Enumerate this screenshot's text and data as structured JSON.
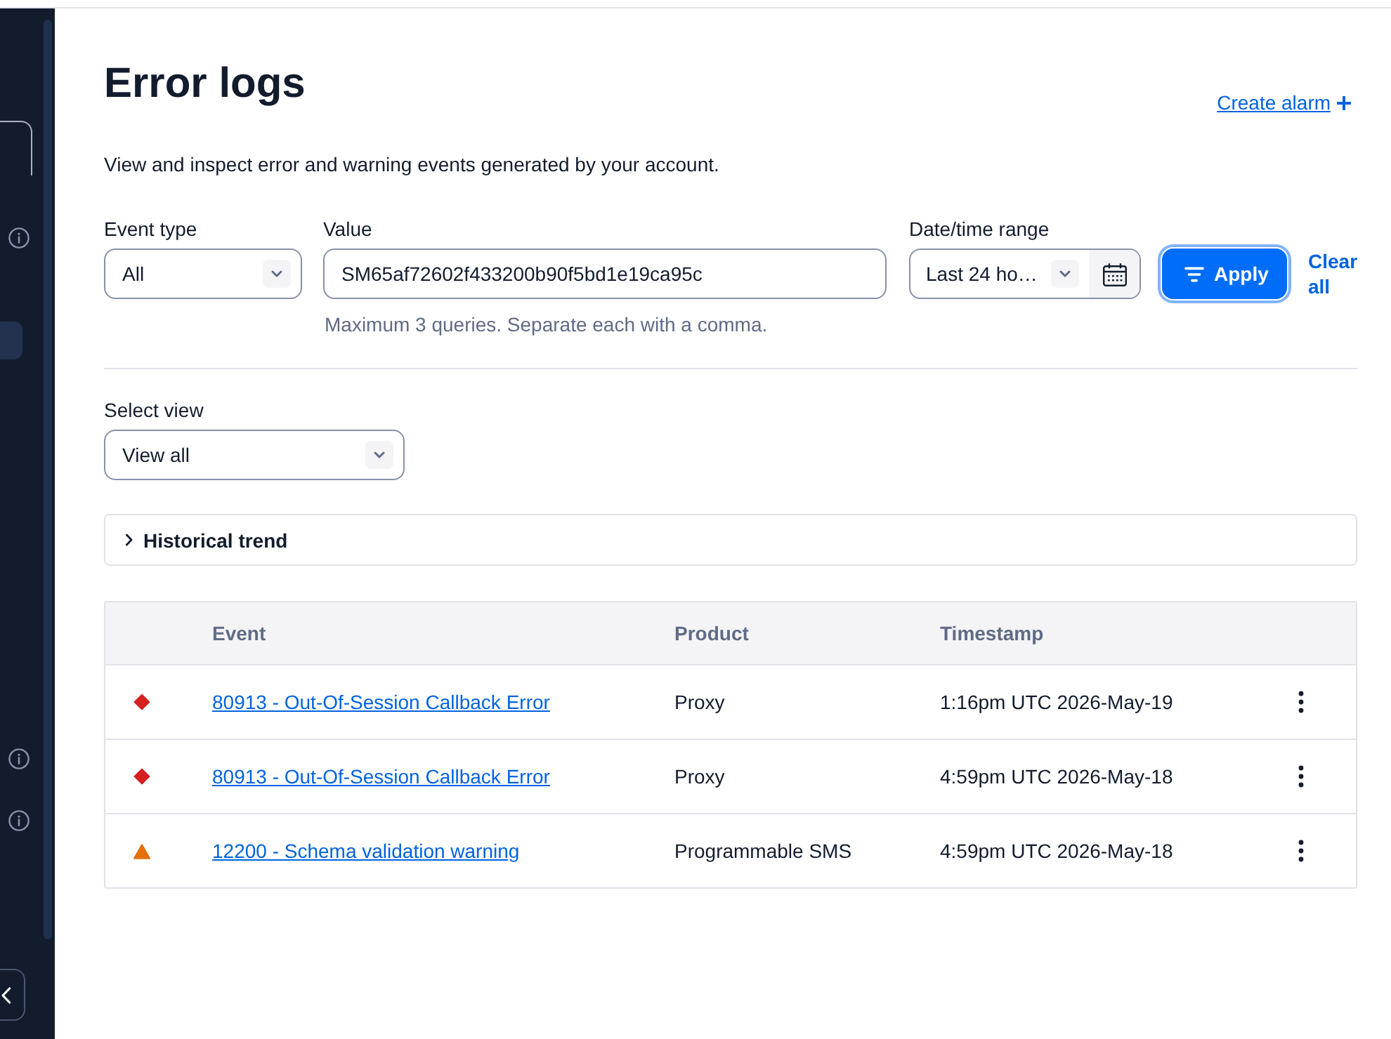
{
  "sidebar": {
    "active_item": {
      "selected": true
    }
  },
  "header": {
    "title": "Error logs",
    "create_alarm": "Create alarm",
    "description": "View and inspect error and warning events generated by your account."
  },
  "filters": {
    "event_type": {
      "label": "Event type",
      "value": "All"
    },
    "value": {
      "label": "Value",
      "value": "SM65af72602f433200b90f5bd1e19ca95c",
      "help": "Maximum 3 queries. Separate each with a comma."
    },
    "date_range": {
      "label": "Date/time range",
      "value": "Last 24 ho…"
    },
    "apply": "Apply",
    "clear": "Clear all"
  },
  "view": {
    "label": "Select view",
    "value": "View all"
  },
  "historical_trend": {
    "label": "Historical trend",
    "expanded": false
  },
  "table": {
    "columns": [
      "Event",
      "Product",
      "Timestamp"
    ],
    "rows": [
      {
        "severity": {
          "kind": "error",
          "color": "#d61f1f"
        },
        "event": "80913 - Out-Of-Session Callback Error",
        "product": "Proxy",
        "timestamp": "1:16pm UTC 2026-May-19"
      },
      {
        "severity": {
          "kind": "error",
          "color": "#d61f1f"
        },
        "event": "80913 - Out-Of-Session Callback Error",
        "product": "Proxy",
        "timestamp": "4:59pm UTC 2026-May-18"
      },
      {
        "severity": {
          "kind": "warning",
          "color": "#e5700b"
        },
        "event": "12200 - Schema validation warning",
        "product": "Programmable SMS",
        "timestamp": "4:59pm UTC 2026-May-18"
      }
    ]
  }
}
